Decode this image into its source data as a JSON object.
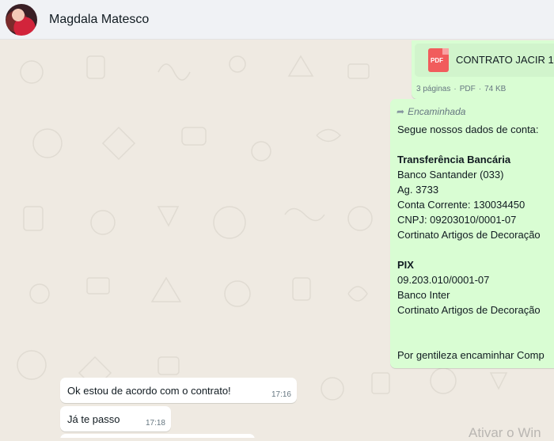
{
  "header": {
    "contact_name": "Magdala Matesco",
    "avatar_icon": "contact-photo"
  },
  "messages": {
    "pdf": {
      "icon": "pdf-file-icon",
      "icon_label": "PDF",
      "file_name": "CONTRATO JACIR 1:",
      "pages": "3 páginas",
      "type": "PDF",
      "size": "74 KB"
    },
    "forwarded": {
      "forward_icon": "forward-arrow-icon",
      "label": "Encaminhada",
      "lines": [
        "Segue nossos dados de conta:",
        "",
        "Transferência Bancária",
        "Banco Santander (033)",
        "Ag. 3733",
        "Conta Corrente: 130034450",
        "CNPJ: 09203010/0001-07",
        "Cortinato Artigos de Decoração",
        "",
        "PIX",
        "09.203.010/0001-07",
        "Banco Inter",
        "Cortinato Artigos de Decoração",
        "",
        "",
        "Por gentileza encaminhar Comp"
      ]
    },
    "incoming": [
      {
        "text": "Ok estou de acordo com o contrato!",
        "time": "17:16"
      },
      {
        "text": "Já te passo",
        "time": "17:18"
      }
    ]
  },
  "watermark": "Ativar o Win",
  "colors": {
    "outgoing_bubble": "#d9fdd3",
    "incoming_bubble": "#ffffff",
    "chat_background": "#efeae2",
    "header_background": "#f0f2f5",
    "pdf_icon": "#f15c5c"
  }
}
